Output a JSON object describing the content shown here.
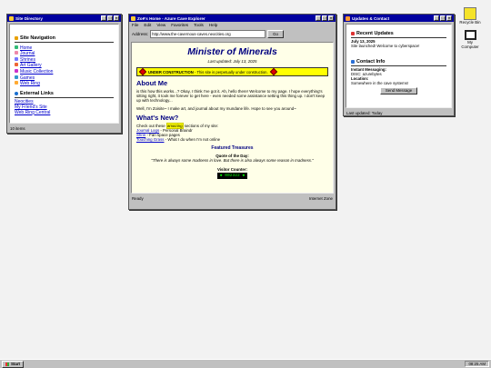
{
  "directory": {
    "title": "Site Directory",
    "nav_heading": "Site Navigation",
    "nav_items": [
      "Home",
      "Journal",
      "Shrines",
      "Art Gallery",
      "Music Collection",
      "Games",
      "Web Ring"
    ],
    "ext_heading": "External Links",
    "ext_items": [
      "Neocities",
      "My Friend's Site",
      "Web Ring Central"
    ],
    "status": "10 items"
  },
  "browser": {
    "title": "Zoë's Home - Azure Cave Explorer",
    "menu": [
      "File",
      "Edit",
      "View",
      "Favorites",
      "Tools",
      "Help"
    ],
    "address_label": "Address:",
    "address": "http://www.the-cavernous-caves.neocities.org",
    "go": "Go",
    "status_left": "Ready",
    "status_right": "Internet Zone"
  },
  "page": {
    "title": "Minister of Minerals",
    "updated": "Last updated: July 13, 2025",
    "construction_bold": "UNDER CONSTRUCTION",
    "construction_rest": " - This site is perpetually under construction.",
    "about_heading": "About Me",
    "about_p1": "is this how this works...? Okay, I think I've got it. Ah, hello there! Welcome to my page. I hope everything's sitting right, it took me forever to get here - even needed some assistance setting this thing up. I don't keep up with technology...",
    "about_p2": "Well, I'm Zoisite~ I make art, and journal about my mundane life. Hope to see you around~",
    "new_heading": "What's New?",
    "new_intro_a": "Check out these ",
    "new_intro_hl": "amazing",
    "new_intro_b": " sections of my site:",
    "new_items": [
      {
        "link": "Journal Logs",
        "text": " - Personal Braindr"
      },
      {
        "link": "Shrin",
        "text": " - Fan space pages"
      },
      {
        "link": "Touching Grass",
        "text": " - What I do when I'm not online"
      }
    ],
    "featured": "Featured Treasures",
    "quote_label": "Quote of the Day:",
    "quote": "\"There is always some madness in love. But there is also always some reason in madness.\"",
    "counter_label": "Visitor Counter:",
    "counter": "002322"
  },
  "updates": {
    "title": "Updates & Contact",
    "recent_heading": "Recent Updates",
    "date": "July 13, 2025",
    "entry": "Site launched! Welcome to cyberspace!",
    "contact_heading": "Contact Info",
    "im_label": "Instant Messaging:",
    "im_value": "DISC: azurebytes",
    "loc_label": "Location:",
    "loc_value": "Somewhere in the cave systems!",
    "send": "Send Message",
    "updated": "Last updated: Today"
  },
  "desktop": {
    "recycle": "Recycle Bin",
    "computer": "My Computer"
  },
  "taskbar": {
    "start": "Start",
    "clock": "08:25 AM"
  },
  "colors": {
    "titlebar": "#0000a0",
    "construction_bg": "#ffff00",
    "diamond": "#e00000",
    "page_bg": "#ffffe8",
    "heading": "#000080"
  }
}
